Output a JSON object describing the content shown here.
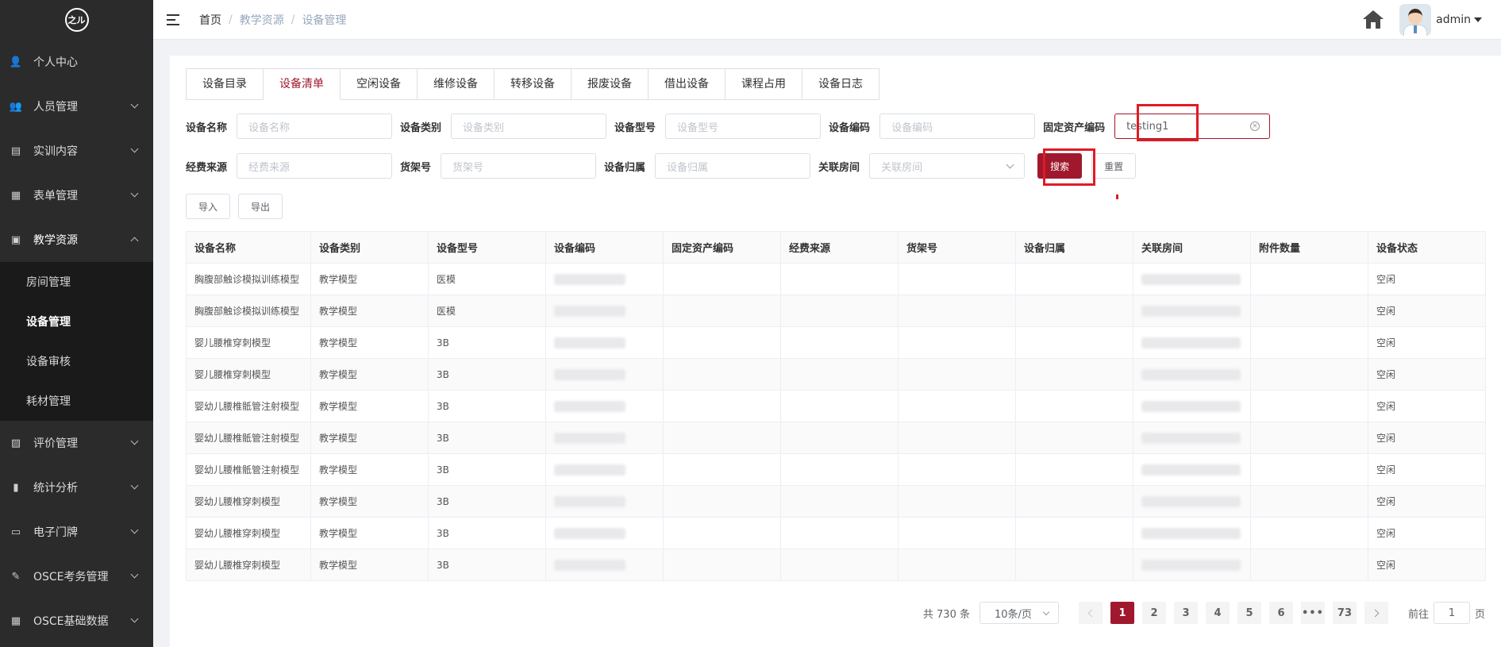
{
  "logo": {
    "text": "之ル"
  },
  "sidebar": {
    "items": [
      {
        "label": "个人中心",
        "icon": "user-icon",
        "glyph": "👤"
      },
      {
        "label": "人员管理",
        "icon": "users-icon",
        "glyph": "👥"
      },
      {
        "label": "实训内容",
        "icon": "content-icon",
        "glyph": "▤"
      },
      {
        "label": "表单管理",
        "icon": "form-icon",
        "glyph": "▦"
      },
      {
        "label": "教学资源",
        "icon": "resource-icon",
        "glyph": "▣"
      },
      {
        "label": "评价管理",
        "icon": "evaluation-icon",
        "glyph": "▨"
      },
      {
        "label": "统计分析",
        "icon": "bar-chart-icon",
        "glyph": "▮"
      },
      {
        "label": "电子门牌",
        "icon": "doorplate-icon",
        "glyph": "▭"
      },
      {
        "label": "OSCE考务管理",
        "icon": "exam-icon",
        "glyph": "✎"
      },
      {
        "label": "OSCE基础数据",
        "icon": "grid-icon",
        "glyph": "▦"
      }
    ],
    "submenu": [
      "房间管理",
      "设备管理",
      "设备审核",
      "耗材管理"
    ]
  },
  "header": {
    "breadcrumb": [
      "首页",
      "教学资源",
      "设备管理"
    ],
    "sep": "/",
    "username": "admin"
  },
  "tabs": [
    "设备目录",
    "设备清单",
    "空闲设备",
    "维修设备",
    "转移设备",
    "报废设备",
    "借出设备",
    "课程占用",
    "设备日志"
  ],
  "search": {
    "row1": [
      {
        "label": "设备名称",
        "placeholder": "设备名称"
      },
      {
        "label": "设备类别",
        "placeholder": "设备类别"
      },
      {
        "label": "设备型号",
        "placeholder": "设备型号"
      },
      {
        "label": "设备编码",
        "placeholder": "设备编码"
      },
      {
        "label": "固定资产编码",
        "value": "testing1",
        "clear": "×"
      }
    ],
    "row2": [
      {
        "label": "经费来源",
        "placeholder": "经费来源"
      },
      {
        "label": "货架号",
        "placeholder": "货架号"
      },
      {
        "label": "设备归属",
        "placeholder": "设备归属"
      },
      {
        "label": "关联房间",
        "placeholder": "关联房间"
      }
    ],
    "search_button": "搜索",
    "reset_button": "重置"
  },
  "actions": {
    "import": "导入",
    "export": "导出"
  },
  "table": {
    "columns": [
      "设备名称",
      "设备类别",
      "设备型号",
      "设备编码",
      "固定资产编码",
      "经费来源",
      "货架号",
      "设备归属",
      "关联房间",
      "附件数量",
      "设备状态"
    ],
    "rows": [
      {
        "name": "胸腹部触诊模拟训练模型",
        "category": "教学模型",
        "model": "医模",
        "status": "空闲"
      },
      {
        "name": "胸腹部触诊模拟训练模型",
        "category": "教学模型",
        "model": "医模",
        "status": "空闲"
      },
      {
        "name": "婴儿腰椎穿刺模型",
        "category": "教学模型",
        "model": "3B",
        "status": "空闲"
      },
      {
        "name": "婴儿腰椎穿刺模型",
        "category": "教学模型",
        "model": "3B",
        "status": "空闲"
      },
      {
        "name": "婴幼儿腰椎骶管注射模型",
        "category": "教学模型",
        "model": "3B",
        "status": "空闲"
      },
      {
        "name": "婴幼儿腰椎骶管注射模型",
        "category": "教学模型",
        "model": "3B",
        "status": "空闲"
      },
      {
        "name": "婴幼儿腰椎骶管注射模型",
        "category": "教学模型",
        "model": "3B",
        "status": "空闲"
      },
      {
        "name": "婴幼儿腰椎穿刺模型",
        "category": "教学模型",
        "model": "3B",
        "status": "空闲"
      },
      {
        "name": "婴幼儿腰椎穿刺模型",
        "category": "教学模型",
        "model": "3B",
        "status": "空闲"
      },
      {
        "name": "婴幼儿腰椎穿刺模型",
        "category": "教学模型",
        "model": "3B",
        "status": "空闲"
      }
    ]
  },
  "pagination": {
    "total": "共 730 条",
    "page_size": "10条/页",
    "pages": [
      "1",
      "2",
      "3",
      "4",
      "5",
      "6",
      "•••",
      "73"
    ],
    "current": "1",
    "goto_prefix": "前往",
    "goto_value": "1",
    "goto_suffix": "页"
  },
  "colors": {
    "accent": "#a0182d",
    "sidebar_bg": "#2b2b2b",
    "highlight": "#e01b24"
  }
}
